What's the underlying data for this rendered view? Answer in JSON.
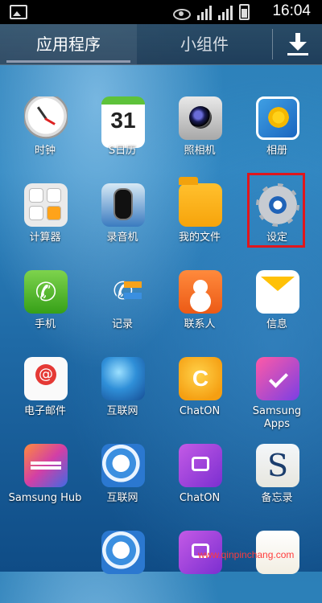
{
  "status_bar": {
    "time": "16:04"
  },
  "tabs": {
    "apps": "应用程序",
    "widgets": "小组件"
  },
  "apps": {
    "clock": "时钟",
    "calendar": "S日历",
    "calendar_day": "31",
    "camera": "照相机",
    "gallery": "相册",
    "calculator": "计算器",
    "recorder": "录音机",
    "my_files": "我的文件",
    "settings": "设定",
    "phone": "手机",
    "logs": "记录",
    "contacts": "联系人",
    "messages": "信息",
    "email": "电子邮件",
    "internet": "互联网",
    "chaton": "ChatON",
    "chaton_letter": "C",
    "samsung_apps_line1": "Samsung",
    "samsung_apps_line2": "Apps",
    "samsung_hub": "Samsung Hub",
    "internet_2": "互联网",
    "chaton_2": "ChatON",
    "memo": "备忘录",
    "memo_letter": "S"
  },
  "watermark": "www.qinpinchang.com"
}
